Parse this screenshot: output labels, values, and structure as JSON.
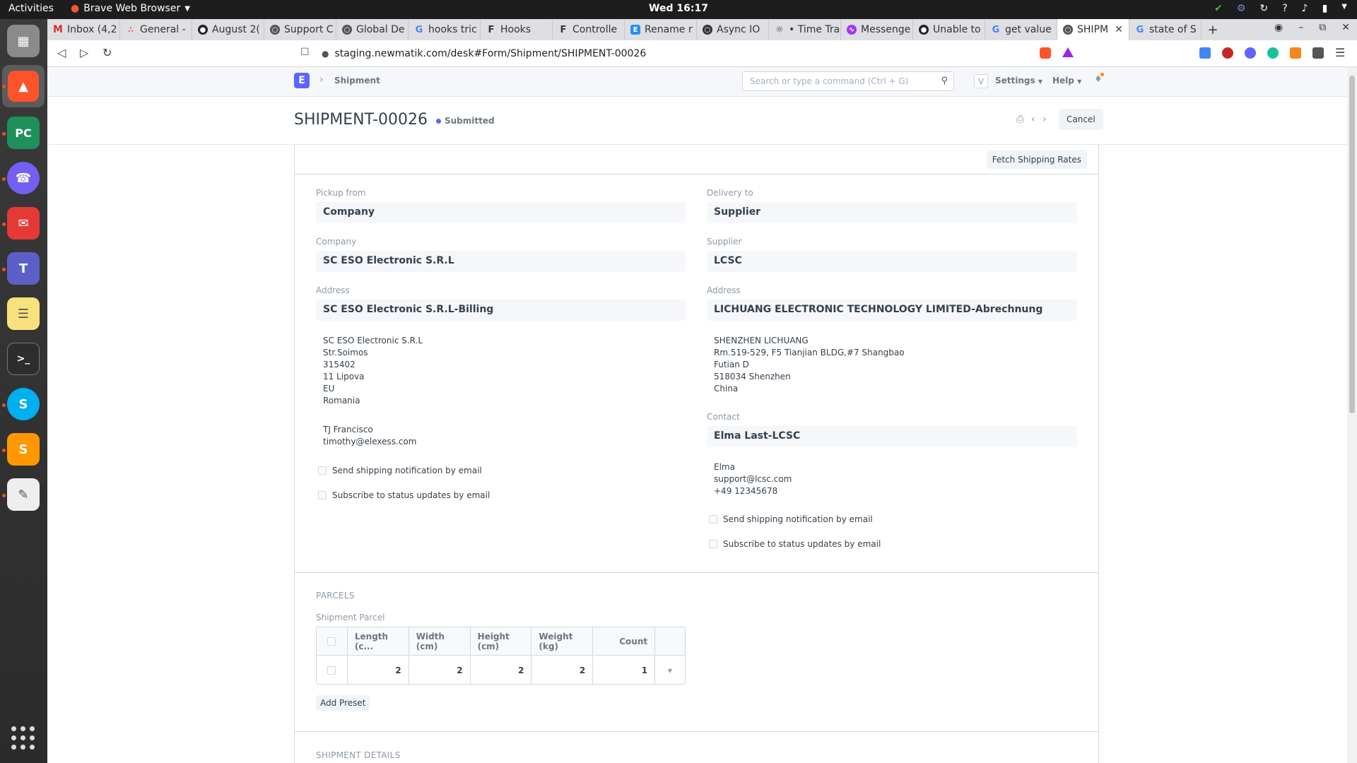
{
  "os": {
    "activities": "Activities",
    "app_name": "Brave Web Browser",
    "clock": "Wed 16:17",
    "tray_icons": [
      "check-icon",
      "bug-icon",
      "refresh-icon",
      "help-icon",
      "volume-icon",
      "battery-icon"
    ]
  },
  "dock": {
    "apps": [
      "files-icon",
      "brave-icon",
      "pycharm-icon",
      "viber-icon",
      "chat-icon",
      "teams-icon",
      "notes-icon",
      "terminal-icon",
      "skype-icon",
      "sublime-icon",
      "editor-icon"
    ]
  },
  "browser": {
    "tabs": [
      {
        "label": "Inbox (4,2",
        "icon": "gmail-icon"
      },
      {
        "label": "General -",
        "icon": "asana-icon"
      },
      {
        "label": "August 2(",
        "icon": "github-icon"
      },
      {
        "label": "Support C",
        "icon": "globe-icon"
      },
      {
        "label": "Global De",
        "icon": "globe-icon"
      },
      {
        "label": "hooks tric",
        "icon": "google-icon"
      },
      {
        "label": "Hooks",
        "icon": "frappe-icon"
      },
      {
        "label": "Controlle",
        "icon": "frappe-icon"
      },
      {
        "label": "Rename r",
        "icon": "erpnext-icon"
      },
      {
        "label": "Async IO",
        "icon": "globe-icon"
      },
      {
        "label": "• Time Tra",
        "icon": "timer-icon"
      },
      {
        "label": "Messenge",
        "icon": "messenger-icon"
      },
      {
        "label": "Unable to",
        "icon": "github-icon"
      },
      {
        "label": "get value",
        "icon": "google-icon"
      },
      {
        "label": "SHIPM",
        "icon": "globe-icon",
        "active": true
      },
      {
        "label": "state of S",
        "icon": "google-icon"
      }
    ],
    "url": "staging.newmatik.com/desk#Form/Shipment/SHIPMENT-00026"
  },
  "navbar": {
    "logo": "E",
    "breadcrumb": "Shipment",
    "search_placeholder": "Search or type a command (Ctrl + G)",
    "avatar": "V",
    "settings": "Settings",
    "help": "Help"
  },
  "page": {
    "title": "SHIPMENT-00026",
    "status": "Submitted",
    "cancel": "Cancel",
    "fetch_rates": "Fetch Shipping Rates"
  },
  "form": {
    "pickup_from_label": "Pickup from",
    "pickup_from": "Company",
    "company_label": "Company",
    "company": "SC ESO Electronic S.R.L",
    "pickup_address_label": "Address",
    "pickup_address": "SC ESO Electronic S.R.L-Billing",
    "pickup_address_lines": [
      "SC ESO Electronic S.R.L",
      "Str.Soimos",
      "315402",
      "11 Lipova",
      "EU",
      "Romania"
    ],
    "pickup_contact_lines": [
      "TJ Francisco",
      "timothy@elexess.com"
    ],
    "delivery_to_label": "Delivery to",
    "delivery_to": "Supplier",
    "supplier_label": "Supplier",
    "supplier": "LCSC",
    "delivery_address_label": "Address",
    "delivery_address": "LICHUANG ELECTRONIC TECHNOLOGY LIMITED-Abrechnung",
    "delivery_address_lines": [
      "SHENZHEN LICHUANG",
      "Rm.519-529, F5 Tianjian BLDG,#7 Shangbao",
      "Futian D",
      "518034 Shenzhen",
      "China"
    ],
    "contact_label": "Contact",
    "contact": "Elma Last-LCSC",
    "delivery_contact_lines": [
      "Elma",
      "support@lcsc.com",
      "+49 12345678"
    ],
    "notify_label": "Send shipping notification by email",
    "subscribe_label": "Subscribe to status updates by email"
  },
  "parcels": {
    "section": "PARCELS",
    "table_label": "Shipment Parcel",
    "columns": [
      "Length (c...",
      "Width (cm)",
      "Height (cm)",
      "Weight (kg)",
      "Count"
    ],
    "rows": [
      [
        "2",
        "2",
        "2",
        "2",
        "1"
      ]
    ],
    "add_preset": "Add Preset"
  },
  "details": {
    "section": "SHIPMENT DETAILS"
  },
  "colors": {
    "accent": "#5e64ff",
    "control_bg": "#f5f7fa",
    "border": "#d1d8dd"
  }
}
